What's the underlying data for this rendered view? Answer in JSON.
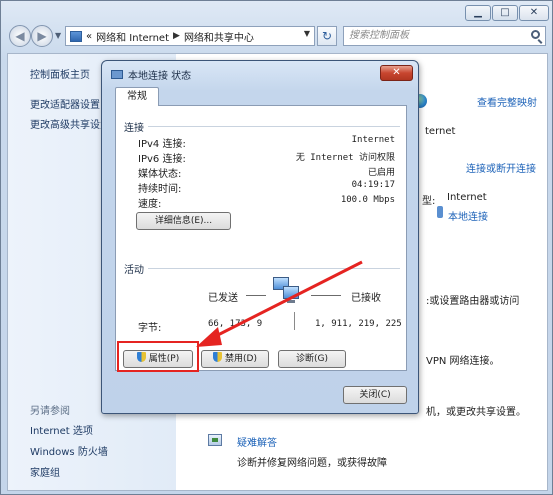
{
  "window": {
    "caption_buttons": {
      "minimize": "▁",
      "maximize": "□",
      "close": "✕"
    },
    "nav": {
      "back": "◀",
      "forward": "▶",
      "address": [
        "«",
        "网络和 Internet",
        "网络和共享中心"
      ],
      "search_placeholder": "搜索控制面板"
    },
    "left_pane": {
      "home": "控制面板主页",
      "links": [
        "更改适配器设置",
        "更改高级共享设置"
      ],
      "see_also_title": "另请参阅",
      "see_also": [
        "Internet 选项",
        "Windows 防火墙",
        "家庭组"
      ]
    },
    "right_pane": {
      "view_full_map": "查看完整映射",
      "internet_partial": "ternet",
      "connect_disconnect": "连接或断开连接",
      "access_type_label": "型:",
      "access_type_value": "Internet",
      "connection_link": "本地连接",
      "text_router": ":或设置路由器或访问",
      "text_vpn": "VPN 网络连接。",
      "text_share": "机，或更改共享设置。",
      "troubleshoot_title": "疑难解答",
      "troubleshoot_desc": "诊断并修复网络问题，或获得故障"
    }
  },
  "dialog": {
    "title": "本地连接 状态",
    "close": "✕",
    "tab": "常规",
    "connection": {
      "title": "连接",
      "rows": [
        {
          "key": "IPv4 连接:",
          "value": "Internet"
        },
        {
          "key": "IPv6 连接:",
          "value": "无 Internet 访问权限"
        },
        {
          "key": "媒体状态:",
          "value": "已启用"
        },
        {
          "key": "持续时间:",
          "value": "04:19:17"
        },
        {
          "key": "速度:",
          "value": "100.0 Mbps"
        }
      ],
      "details_button": "详细信息(E)..."
    },
    "activity": {
      "title": "活动",
      "sent_label": "已发送",
      "received_label": "已接收",
      "bytes_label": "字节:",
      "bytes_sent": "66, 173, 9",
      "bytes_received": "1, 911, 219, 225"
    },
    "buttons": {
      "properties": "属性(P)",
      "disable": "禁用(D)",
      "diagnose": "诊断(G)",
      "close": "关闭(C)"
    }
  },
  "colors": {
    "annotation": "#e52421",
    "link": "#1c62b8"
  }
}
